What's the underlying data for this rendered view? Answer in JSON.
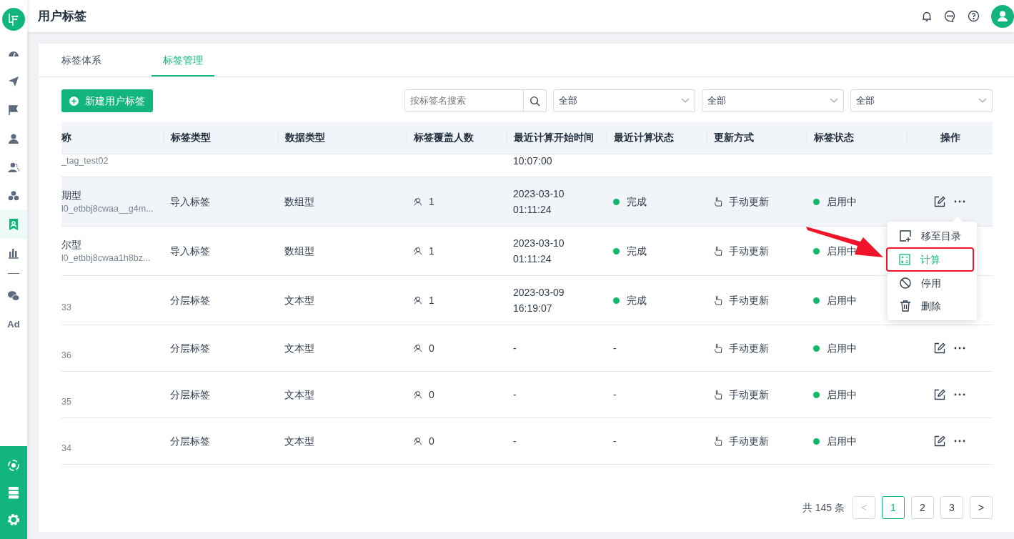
{
  "header": {
    "title": "用户标签"
  },
  "sidebar": {
    "items": [
      {
        "kind": "icon",
        "selected": false
      },
      {
        "kind": "icon",
        "selected": false
      },
      {
        "kind": "icon",
        "selected": false
      },
      {
        "kind": "icon",
        "selected": false
      },
      {
        "kind": "icon",
        "selected": false
      },
      {
        "kind": "icon",
        "selected": false
      },
      {
        "kind": "icon",
        "selected": true
      },
      {
        "kind": "icon",
        "selected": false
      },
      {
        "kind": "divider"
      },
      {
        "kind": "icon",
        "selected": false
      },
      {
        "kind": "text",
        "label": "Ad",
        "selected": false
      }
    ]
  },
  "tabs": [
    {
      "label": "标签体系",
      "selected": false
    },
    {
      "label": "标签管理",
      "selected": true
    }
  ],
  "toolbar": {
    "new_button": "新建用户标签",
    "search": {
      "placeholder": "按标签名搜索"
    },
    "filters": [
      "全部",
      "全部",
      "全部"
    ]
  },
  "table": {
    "columns": [
      "称",
      "标签类型",
      "数据类型",
      "标签覆盖人数",
      "最近计算开始时间",
      "最近计算状态",
      "更新方式",
      "标签状态",
      "操作"
    ],
    "rows": [
      {
        "kind": "partial",
        "code": "_tag_test02",
        "time_clock": "10:07:00"
      },
      {
        "kind": "full",
        "hovered": true,
        "name": "期型",
        "code": "l0_etbbj8cwaa__g4m...",
        "tag_type": "导入标签",
        "data_type": "数组型",
        "coverage": "1",
        "time_date": "2023-03-10",
        "time_clock": "01:11:24",
        "calc_status": {
          "text": "完成",
          "color": "#12b76a"
        },
        "update_mode": "手动更新",
        "tag_status": {
          "text": "启用中",
          "color": "#12b76a"
        }
      },
      {
        "kind": "full",
        "hovered": false,
        "name": "尔型",
        "code": "l0_etbbj8cwaa1h8bz...",
        "tag_type": "导入标签",
        "data_type": "数组型",
        "coverage": "1",
        "time_date": "2023-03-10",
        "time_clock": "01:11:24",
        "calc_status": {
          "text": "完成",
          "color": "#12b76a"
        },
        "update_mode": "手动更新",
        "tag_status": {
          "text": "启用中",
          "color": "#12b76a"
        }
      },
      {
        "kind": "full",
        "hovered": false,
        "code": "33",
        "tag_type": "分层标签",
        "data_type": "文本型",
        "coverage": "1",
        "time_date": "2023-03-09",
        "time_clock": "16:19:07",
        "calc_status": {
          "text": "完成",
          "color": "#12b76a"
        },
        "update_mode": "手动更新",
        "tag_status": {
          "text": "启用中",
          "color": "#12b76a"
        }
      },
      {
        "kind": "full",
        "hovered": false,
        "code": "36",
        "tag_type": "分层标签",
        "data_type": "文本型",
        "coverage": "0",
        "time_date": "-",
        "calc_status": {
          "text": "-"
        },
        "update_mode": "手动更新",
        "tag_status": {
          "text": "启用中",
          "color": "#12b76a"
        }
      },
      {
        "kind": "full",
        "hovered": false,
        "code": "35",
        "tag_type": "分层标签",
        "data_type": "文本型",
        "coverage": "0",
        "time_date": "-",
        "calc_status": {
          "text": "-"
        },
        "update_mode": "手动更新",
        "tag_status": {
          "text": "启用中",
          "color": "#12b76a"
        }
      },
      {
        "kind": "full",
        "hovered": false,
        "code": "34",
        "tag_type": "分层标签",
        "data_type": "文本型",
        "coverage": "0",
        "time_date": "-",
        "calc_status": {
          "text": "-"
        },
        "update_mode": "手动更新",
        "tag_status": {
          "text": "启用中",
          "color": "#12b76a"
        }
      }
    ]
  },
  "menu": {
    "items": [
      {
        "label": "移至目录",
        "selected": false
      },
      {
        "label": "计算",
        "selected": true
      },
      {
        "label": "停用",
        "selected": false
      },
      {
        "label": "删除",
        "selected": false
      }
    ]
  },
  "pagination": {
    "total": "共 145 条",
    "prev": "<",
    "next": ">",
    "pages": [
      {
        "label": "1",
        "selected": true
      },
      {
        "label": "2",
        "selected": false
      },
      {
        "label": "3",
        "selected": false
      }
    ]
  }
}
